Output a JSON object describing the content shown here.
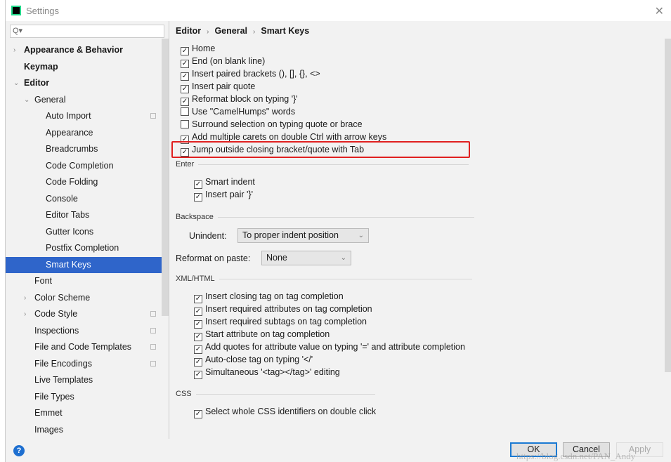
{
  "window": {
    "title": "Settings",
    "close": "✕"
  },
  "search": {
    "placeholder": "Q▾"
  },
  "sidebar": {
    "items": [
      {
        "label": "Appearance & Behavior",
        "level": 0,
        "arrow": "›",
        "bold": true
      },
      {
        "label": "Keymap",
        "level": 0,
        "arrow": "",
        "bold": true
      },
      {
        "label": "Editor",
        "level": 0,
        "arrow": "⌄",
        "bold": true
      },
      {
        "label": "General",
        "level": 1,
        "arrow": "⌄"
      },
      {
        "label": "Auto Import",
        "level": 2,
        "project": true
      },
      {
        "label": "Appearance",
        "level": 2
      },
      {
        "label": "Breadcrumbs",
        "level": 2
      },
      {
        "label": "Code Completion",
        "level": 2
      },
      {
        "label": "Code Folding",
        "level": 2
      },
      {
        "label": "Console",
        "level": 2
      },
      {
        "label": "Editor Tabs",
        "level": 2
      },
      {
        "label": "Gutter Icons",
        "level": 2
      },
      {
        "label": "Postfix Completion",
        "level": 2
      },
      {
        "label": "Smart Keys",
        "level": 2,
        "selected": true
      },
      {
        "label": "Font",
        "level": 1
      },
      {
        "label": "Color Scheme",
        "level": 1,
        "arrow": "›"
      },
      {
        "label": "Code Style",
        "level": 1,
        "arrow": "›",
        "project": true
      },
      {
        "label": "Inspections",
        "level": 1,
        "project": true
      },
      {
        "label": "File and Code Templates",
        "level": 1,
        "project": true
      },
      {
        "label": "File Encodings",
        "level": 1,
        "project": true
      },
      {
        "label": "Live Templates",
        "level": 1
      },
      {
        "label": "File Types",
        "level": 1
      },
      {
        "label": "Emmet",
        "level": 1
      },
      {
        "label": "Images",
        "level": 1
      }
    ]
  },
  "breadcrumb": [
    "Editor",
    "General",
    "Smart Keys"
  ],
  "general_options": [
    {
      "label": "Home",
      "checked": true
    },
    {
      "label": "End (on blank line)",
      "checked": true
    },
    {
      "label": "Insert paired brackets (), [], {}, <>",
      "checked": true
    },
    {
      "label": "Insert pair quote",
      "checked": true
    },
    {
      "label": "Reformat block on typing '}'",
      "checked": true
    },
    {
      "label": "Use \"CamelHumps\" words",
      "checked": false
    },
    {
      "label": "Surround selection on typing quote or brace",
      "checked": false
    },
    {
      "label": "Add multiple carets on double Ctrl with arrow keys",
      "checked": true
    },
    {
      "label": "Jump outside closing bracket/quote with Tab",
      "checked": true,
      "highlighted": true
    }
  ],
  "enter": {
    "title": "Enter",
    "options": [
      {
        "label": "Smart indent",
        "checked": true
      },
      {
        "label": "Insert pair '}'",
        "checked": true
      }
    ]
  },
  "backspace": {
    "title": "Backspace",
    "unindent_label": "Unindent:",
    "unindent_value": "To proper indent position"
  },
  "reformat": {
    "label": "Reformat on paste:",
    "value": "None"
  },
  "xml": {
    "title": "XML/HTML",
    "options": [
      {
        "label": "Insert closing tag on tag completion",
        "checked": true
      },
      {
        "label": "Insert required attributes on tag completion",
        "checked": true
      },
      {
        "label": "Insert required subtags on tag completion",
        "checked": true
      },
      {
        "label": "Start attribute on tag completion",
        "checked": true
      },
      {
        "label": "Add quotes for attribute value on typing '=' and attribute completion",
        "checked": true
      },
      {
        "label": "Auto-close tag on typing '</'",
        "checked": true
      },
      {
        "label": "Simultaneous '<tag></tag>' editing",
        "checked": true
      }
    ]
  },
  "css": {
    "title": "CSS",
    "options": [
      {
        "label": "Select whole CSS identifiers on double click",
        "checked": true
      }
    ]
  },
  "buttons": {
    "ok": "OK",
    "cancel": "Cancel",
    "apply": "Apply",
    "help": "?"
  },
  "watermark": "https://blog.csdn.net/PAN_Andy",
  "colors": {
    "selection": "#2f65ca",
    "highlight_box": "#e02020"
  }
}
